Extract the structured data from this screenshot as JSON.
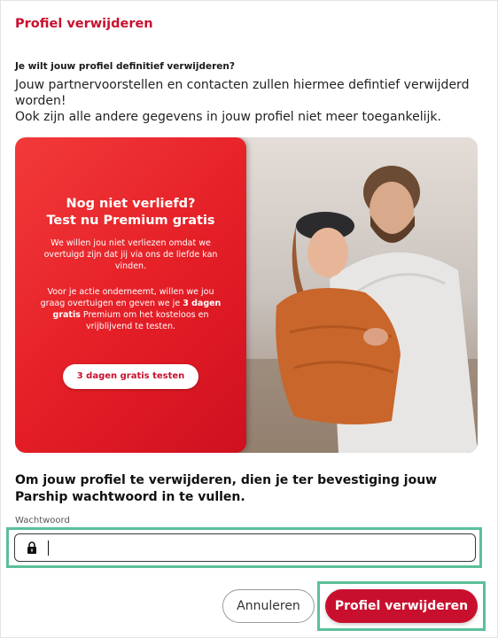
{
  "dialog": {
    "title": "Profiel verwijderen",
    "question": "Je wilt jouw profiel definitief verwijderen?",
    "description_line1": "Jouw partnervoorstellen en contacten zullen hiermee defintief verwijderd worden!",
    "description_line2": "Ook zijn alle andere gegevens in jouw profiel niet meer toegankelijk."
  },
  "promo": {
    "headline_line1": "Nog niet verliefd?",
    "headline_line2": "Test nu Premium gratis",
    "paragraph1": "We willen jou niet verliezen omdat we overtuigd zijn dat jij via ons de liefde kan vinden.",
    "paragraph2_before": "Voor je actie onderneemt, willen we jou graag overtuigen en geven we je ",
    "paragraph2_bold": "3 dagen gratis",
    "paragraph2_after": " Premium om het kosteloos en vrijblijvend te testen.",
    "button_label": "3 dagen gratis testen",
    "image_icon": "couple-photo"
  },
  "confirm": {
    "text": "Om jouw profiel te verwijderen, dien je ter bevestiging jouw Parship wachtwoord in te vullen.",
    "password_label": "Wachtwoord",
    "password_value": "",
    "lock_icon": "lock-icon"
  },
  "actions": {
    "cancel_label": "Annuleren",
    "delete_label": "Profiel verwijderen"
  },
  "colors": {
    "brand_red": "#c8102e",
    "promo_red": "#e41e26",
    "highlight_green": "#5cbf9a"
  }
}
